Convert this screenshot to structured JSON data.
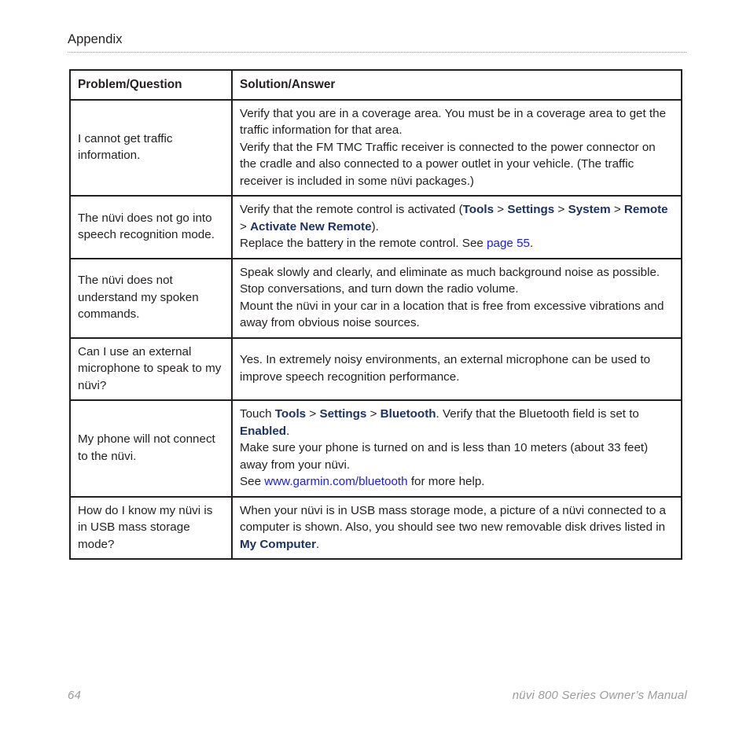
{
  "page": {
    "chapter_title": "Appendix",
    "folio": "64",
    "manual_title": "nüvi 800 Series Owner’s Manual"
  },
  "colors": {
    "text": "#231f20",
    "menu_bold": "#1b3263",
    "link": "#1b1be2",
    "footer": "#9b9b9b",
    "rule": "#9d9d9d"
  },
  "table": {
    "headers": {
      "question": "Problem/Question",
      "answer": "Solution/Answer"
    },
    "rows": [
      {
        "question": "I cannot get traffic information.",
        "answer_paragraphs": [
          "Verify that you are in a coverage area. You must be in a coverage area to get the traffic information for that area.",
          "Verify that the FM TMC Traffic receiver is connected to the power connector on the cradle and also connected to a power outlet in your vehicle. (The traffic receiver is included in some nüvi packages.)"
        ]
      },
      {
        "question": "The nüvi does not go into speech recognition mode.",
        "answer_line1_prefix": "Verify that the remote control is activated (",
        "answer_line1_menu": [
          "Tools",
          "Settings",
          "System",
          "Remote",
          "Activate New Remote"
        ],
        "answer_line1_suffix": ").",
        "answer_line2_prefix": "Replace the battery in the remote control. See ",
        "answer_line2_link": "page 55",
        "answer_line2_suffix": "."
      },
      {
        "question": "The nüvi does not understand my spoken commands.",
        "answer_paragraphs": [
          "Speak slowly and clearly, and eliminate as much background noise as possible. Stop conversations, and turn down the radio volume.",
          "Mount the nüvi in your car in a location that is free from excessive vibrations and away from obvious noise sources."
        ]
      },
      {
        "question": "Can I use an external microphone to speak to my nüvi?",
        "answer_paragraphs": [
          "Yes. In extremely noisy environments, an external microphone can be used to improve speech recognition performance."
        ]
      },
      {
        "question": "My phone will not connect to the nüvi.",
        "answer_line1_prefix": "Touch ",
        "answer_line1_menu": [
          "Tools",
          "Settings",
          "Bluetooth"
        ],
        "answer_line1_mid": ". Verify that the Bluetooth field is set to ",
        "answer_line1_menu2": "Enabled",
        "answer_line1_suffix": ".",
        "answer_line2": "Make sure your phone is turned on and is less than 10 meters (about 33 feet) away from your nüvi.",
        "answer_line3_prefix": "See ",
        "answer_line3_link": "www.garmin.com/bluetooth",
        "answer_line3_suffix": " for more help."
      },
      {
        "question": "How do I know my nüvi is in USB mass storage mode?",
        "answer_line1_prefix": "When your nüvi is in USB mass storage mode, a picture of a nüvi connected to a computer is shown. Also, you should see two new removable disk drives listed in ",
        "answer_line1_menu": "My Computer",
        "answer_line1_suffix": "."
      }
    ]
  },
  "separators": {
    "gt": " > "
  }
}
